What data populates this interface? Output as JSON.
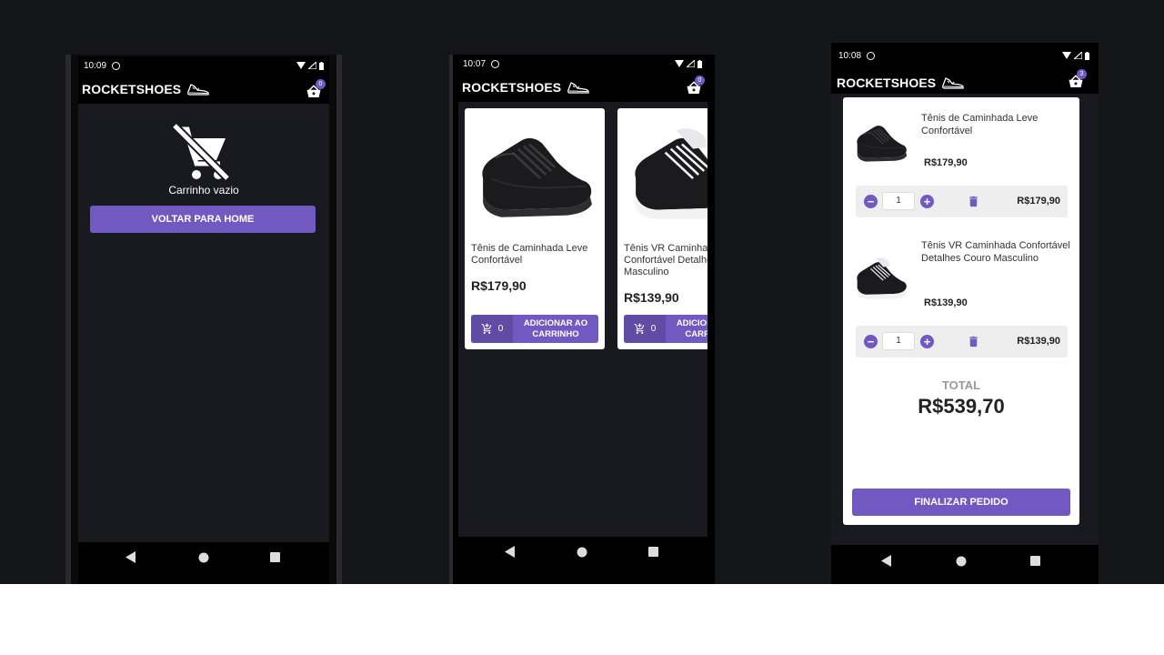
{
  "brand": {
    "name": "ROCKETSHOES",
    "logo_icon": "sneaker-icon"
  },
  "colors": {
    "accent": "#7159c1",
    "background": "#191920",
    "surface": "#ffffff"
  },
  "screens": {
    "empty_cart": {
      "time": "10:09",
      "cart_count": "0",
      "message": "Carrinho vazio",
      "back_button": "VOLTAR PARA HOME"
    },
    "home": {
      "time": "10:07",
      "cart_count": "0",
      "products": [
        {
          "title": "Tênis de Caminhada Leve Confortável",
          "price": "R$179,90",
          "amount": "0",
          "button": "ADICIONAR AO CARRINHO",
          "shoe_color": "black"
        },
        {
          "title": "Tênis VR Caminhada Confortável Detalhes Couro Masculino",
          "price": "R$139,90",
          "amount": "0",
          "button": "ADICIONAR AO CARRINHO",
          "shoe_color": "black-white"
        }
      ]
    },
    "cart": {
      "time": "10:08",
      "cart_count": "3",
      "items": [
        {
          "title": "Tênis de Caminhada Leve Confortável",
          "price": "R$179,90",
          "amount": "1",
          "subtotal": "R$179,90"
        },
        {
          "title": "Tênis VR Caminhada Confortável Detalhes Couro Masculino",
          "price": "R$139,90",
          "amount": "1",
          "subtotal": "R$139,90"
        }
      ],
      "total_label": "TOTAL",
      "total": "R$539,70",
      "checkout_button": "FINALIZAR PEDIDO"
    }
  }
}
